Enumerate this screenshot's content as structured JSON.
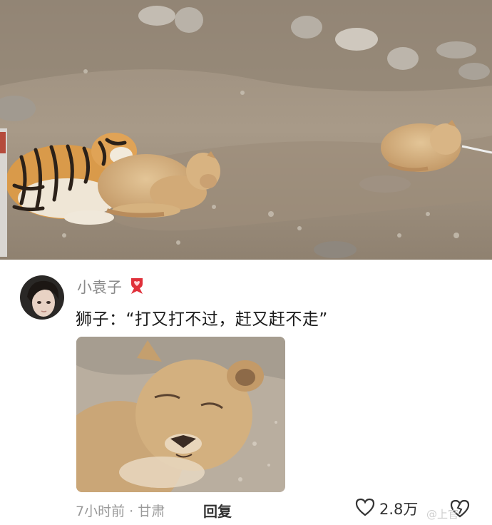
{
  "post_image": {
    "description_icon": "tiger-and-lions-photo"
  },
  "comment": {
    "username": "小袁子",
    "badge_icon": "red-heart-badge-icon",
    "text": "狮子：“打又打不过，赶又赶不走”",
    "time": "7小时前",
    "separator": "·",
    "location": "甘肃",
    "reply_label": "回复",
    "like_count": "2.8万",
    "watermark": "@上官"
  },
  "colors": {
    "meta_gray": "#999999",
    "text_dark": "#1a1a1a",
    "badge_red": "#e0303a"
  }
}
